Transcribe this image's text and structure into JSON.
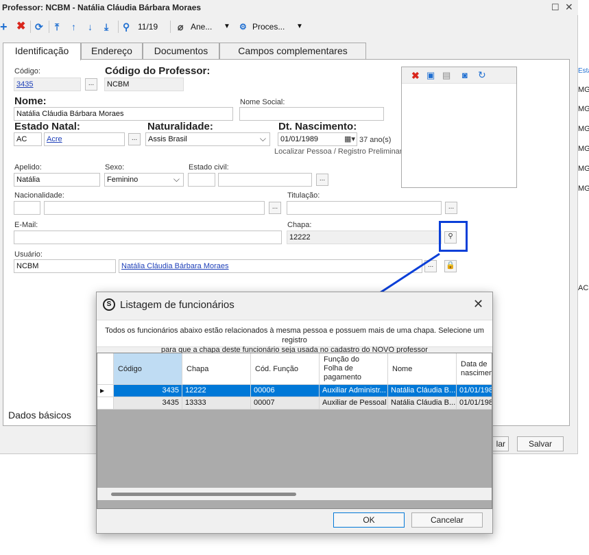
{
  "window": {
    "title": "Professor: NCBM - Natália Cláudia Bárbara Moraes"
  },
  "toolbar": {
    "counter": "11/19",
    "anexos_label": "Ane...",
    "processos_label": "Proces..."
  },
  "tabs": [
    "Identificação",
    "Endereço",
    "Documentos",
    "Campos complementares"
  ],
  "form": {
    "codigo_label": "Código:",
    "codigo_value": "3435",
    "codigo_prof_label": "Código do Professor:",
    "codigo_prof_value": "NCBM",
    "nome_label": "Nome:",
    "nome_value": "Natália Cláudia Bárbara Moraes",
    "nome_social_label": "Nome Social:",
    "estado_natal_label": "Estado Natal:",
    "estado_uf": "AC",
    "estado_nome": "Acre",
    "naturalidade_label": "Naturalidade:",
    "naturalidade_value": "Assis Brasil",
    "dt_nasc_label": "Dt. Nascimento:",
    "dt_nasc_value": "01/01/1989",
    "idade": "37 ano(s)",
    "localizar_link": "Localizar Pessoa / Registro Preliminar",
    "apelido_label": "Apelido:",
    "apelido_value": "Natália",
    "sexo_label": "Sexo:",
    "sexo_value": "Feminino",
    "estado_civil_label": "Estado civil:",
    "nacionalidade_label": "Nacionalidade:",
    "titulacao_label": "Titulação:",
    "email_label": "E-Mail:",
    "chapa_label": "Chapa:",
    "chapa_value": "12222",
    "usuario_label": "Usuário:",
    "usuario_value": "NCBM",
    "usuario_nome": "Natália Cláudia Bárbara Moraes"
  },
  "bottom": {
    "tab_label": "Dados básicos",
    "cancel_partial": "lar",
    "save_label": "Salvar"
  },
  "right_strip": {
    "header": "Esta",
    "rows": [
      "MG",
      "MG",
      "MG",
      "MG",
      "MG",
      "MG",
      "AC"
    ]
  },
  "dialog": {
    "title": "Listagem de funcionários",
    "message_line1": "Todos os funcionários abaixo estão relacionados à mesma pessoa e possuem mais de uma chapa. Selecione um registro",
    "message_line2": "para que a chapa deste funcionário seja usada no cadastro do NOVO professor",
    "columns": [
      "Código",
      "Chapa",
      "Cód. Função",
      "Função do\nFolha de\npagamento",
      "Nome",
      "Data de\nnascimento"
    ],
    "rows": [
      [
        "3435",
        "12222",
        "00006",
        "Auxiliar Administr...",
        "Natália Cláudia B...",
        "01/01/198"
      ],
      [
        "3435",
        "13333",
        "00007",
        "Auxiliar de Pessoal",
        "Natália Cláudia B...",
        "01/01/198"
      ]
    ],
    "ok_label": "OK",
    "cancel_label": "Cancelar"
  },
  "colors": {
    "highlight": "#0a3fd8",
    "selected_row": "#0078d7",
    "header_selected": "#bfdcf3"
  }
}
